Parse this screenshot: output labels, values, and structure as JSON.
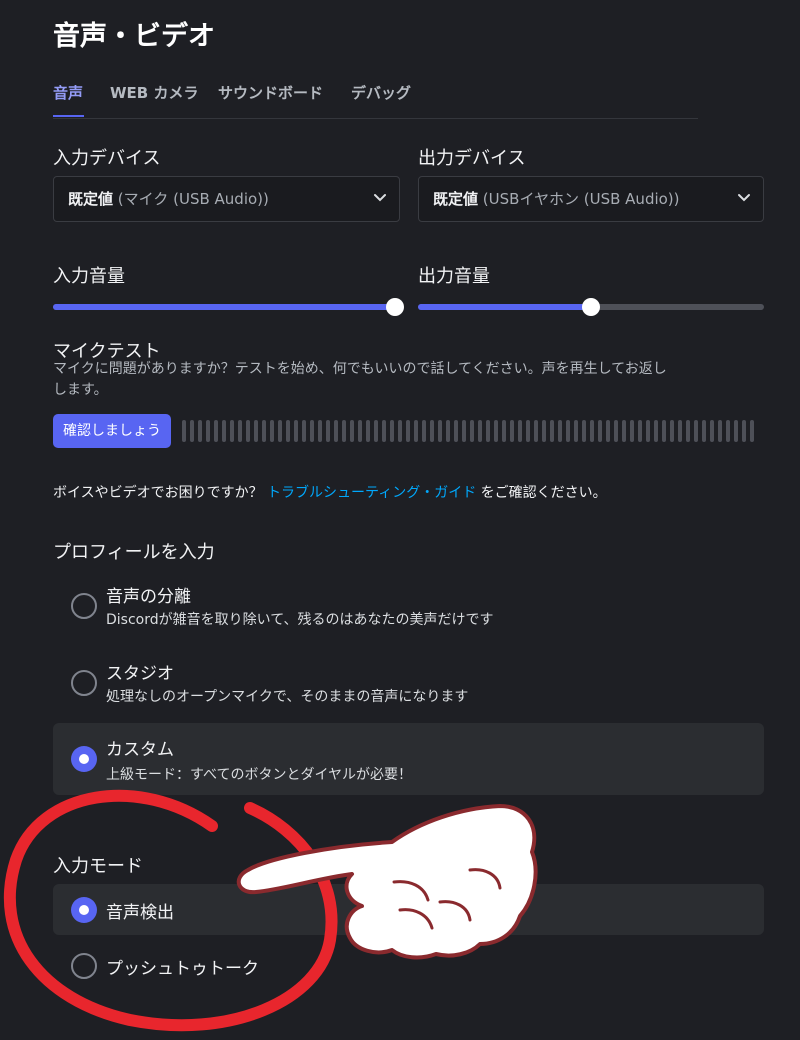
{
  "page": {
    "title": "音声・ビデオ"
  },
  "tabs": [
    {
      "label": "音声",
      "active": true
    },
    {
      "label": "WEB カメラ",
      "active": false
    },
    {
      "label": "サウンドボード",
      "active": false
    },
    {
      "label": "デバッグ",
      "active": false
    }
  ],
  "devices": {
    "input_label": "入力デバイス",
    "input_value_strong": "既定値",
    "input_value_detail": "(マイク (USB Audio))",
    "output_label": "出力デバイス",
    "output_value_strong": "既定値",
    "output_value_detail": "(USBイヤホン (USB Audio))"
  },
  "volume": {
    "input_label": "入力音量",
    "input_level": 1.0,
    "output_label": "出力音量",
    "output_level": 0.5
  },
  "mic_test": {
    "title": "マイクテスト",
    "description": "マイクに問題がありますか？テストを始め、何でもいいので話してください。声を再生してお返しします。",
    "button_label": "確認しましょう"
  },
  "help": {
    "prefix": "ボイスやビデオでお困りですか？",
    "link": "トラブルシューティング・ガイド",
    "suffix": "をご確認ください。"
  },
  "input_profile": {
    "title": "プロフィールを入力",
    "options": [
      {
        "title": "音声の分離",
        "description": "Discordが雑音を取り除いて、残るのはあなたの美声だけです",
        "selected": false
      },
      {
        "title": "スタジオ",
        "description": "処理なしのオープンマイクで、そのままの音声になります",
        "selected": false
      },
      {
        "title": "カスタム",
        "description": "上級モード：すべてのボタンとダイヤルが必要！",
        "selected": true
      }
    ]
  },
  "input_mode": {
    "title": "入力モード",
    "options": [
      {
        "title": "音声検出",
        "selected": true
      },
      {
        "title": "プッシュトゥトーク",
        "selected": false
      }
    ]
  },
  "colors": {
    "background": "#1e1f24",
    "accent": "#5865f2",
    "link": "#00a8fc",
    "annotation_red": "#e8262d"
  },
  "icons": {
    "select_arrow": "chevron-down-icon",
    "annotation": [
      "red-circle-annotation",
      "pointing-hand-icon"
    ]
  }
}
